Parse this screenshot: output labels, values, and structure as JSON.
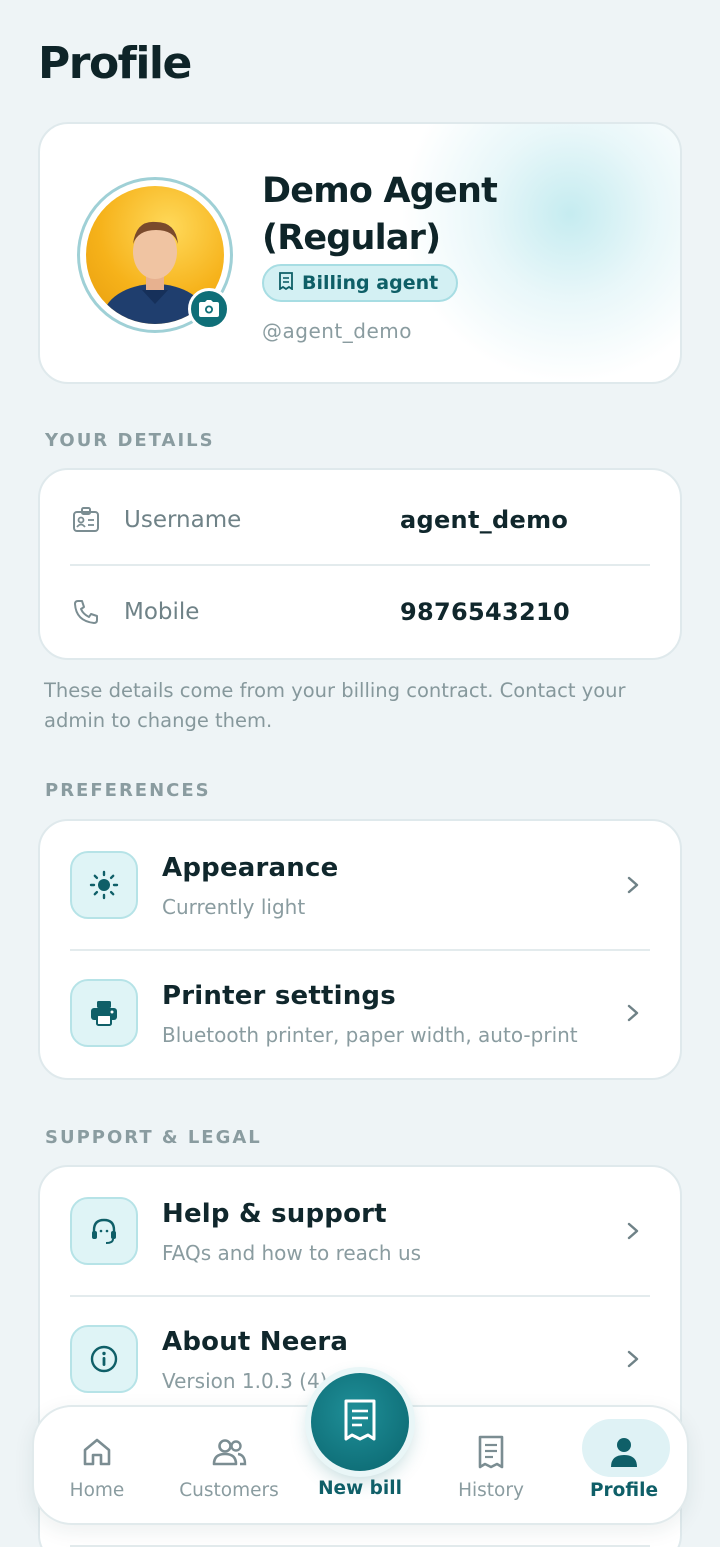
{
  "page": {
    "title": "Profile"
  },
  "profile": {
    "name": "Demo Agent (Regular)",
    "role": "Billing agent",
    "handle": "@agent_demo",
    "avatar_icon": "user-photo",
    "camera_icon": "camera-icon"
  },
  "details": {
    "section_label": "YOUR DETAILS",
    "rows": [
      {
        "icon": "id-card-icon",
        "label": "Username",
        "value": "agent_demo"
      },
      {
        "icon": "phone-icon",
        "label": "Mobile",
        "value": "9876543210"
      }
    ],
    "note": "These details come from your billing contract. Contact your admin to change them."
  },
  "preferences": {
    "section_label": "PREFERENCES",
    "items": [
      {
        "icon": "sun-icon",
        "title": "Appearance",
        "subtitle": "Currently light"
      },
      {
        "icon": "printer-icon",
        "title": "Printer settings",
        "subtitle": "Bluetooth printer, paper width, auto-print"
      }
    ]
  },
  "support": {
    "section_label": "SUPPORT & LEGAL",
    "items": [
      {
        "icon": "headset-icon",
        "title": "Help & support",
        "subtitle": "FAQs and how to reach us"
      },
      {
        "icon": "info-icon",
        "title": "About Neera",
        "subtitle": "Version 1.0.3 (4)"
      }
    ]
  },
  "tabbar": {
    "tabs": [
      {
        "icon": "home-icon",
        "label": "Home"
      },
      {
        "icon": "customers-icon",
        "label": "Customers"
      },
      {
        "icon": "receipt-icon",
        "label": "New bill"
      },
      {
        "icon": "history-icon",
        "label": "History"
      },
      {
        "icon": "profile-icon",
        "label": "Profile"
      }
    ],
    "active": "Profile"
  },
  "colors": {
    "accent": "#0f6f78",
    "background": "#eef4f6",
    "chip_bg": "#d3f0f3"
  }
}
